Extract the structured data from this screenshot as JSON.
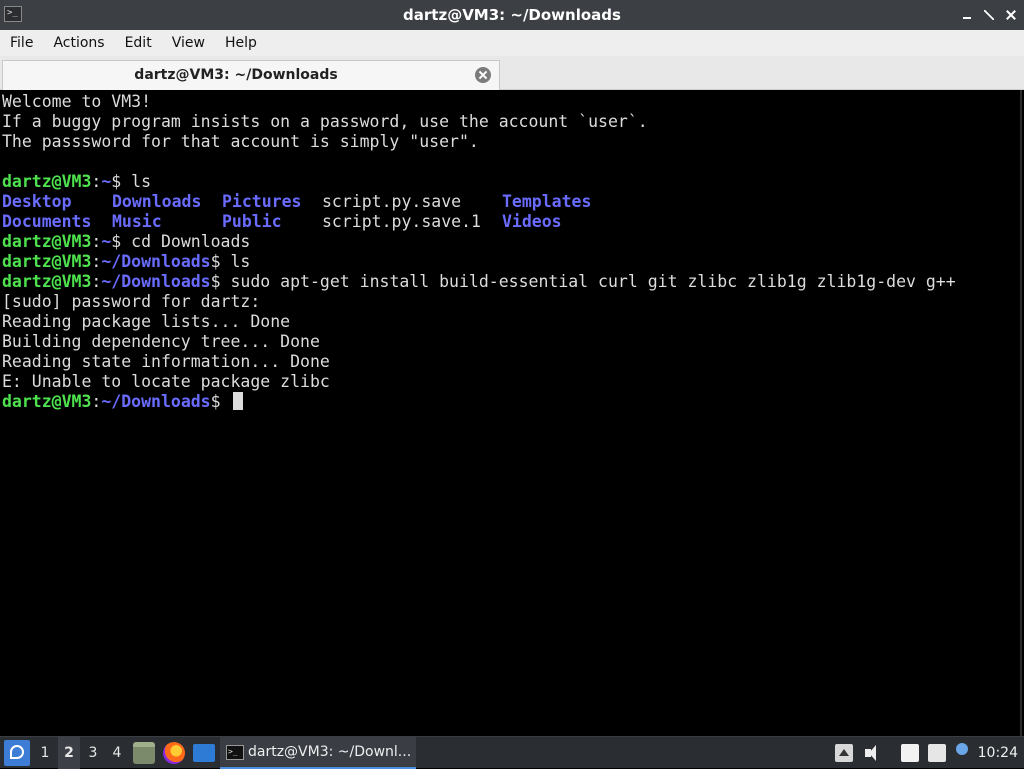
{
  "window": {
    "title": "dartz@VM3: ~/Downloads",
    "app_icon_text": ">_",
    "controls": [
      "minimize",
      "maximize",
      "close"
    ]
  },
  "menubar": {
    "items": [
      "File",
      "Actions",
      "Edit",
      "View",
      "Help"
    ]
  },
  "tabs": [
    {
      "label": "dartz@VM3: ~/Downloads",
      "active": true,
      "close_icon": "close-circle-icon"
    }
  ],
  "terminal": {
    "welcome": [
      "Welcome to VM3!",
      "If a buggy program insists on a password, use the account `user`.",
      "The passsword for that account is simply \"user\"."
    ],
    "prompt_user": "dartz@VM3",
    "prompt_colon": ":",
    "cmd1": {
      "path": "~",
      "dollar": "$ ",
      "command": "ls"
    },
    "ls_row1": [
      "Desktop",
      "Downloads",
      "Pictures",
      "script.py.save",
      "Templates"
    ],
    "ls_row2": [
      "Documents",
      "Music",
      "Public",
      "script.py.save.1",
      "Videos"
    ],
    "cmd2": {
      "path": "~",
      "dollar": "$ ",
      "command": "cd Downloads"
    },
    "cmd3": {
      "path": "~/Downloads",
      "dollar": "$ ",
      "command": "ls"
    },
    "cmd4": {
      "path": "~/Downloads",
      "dollar": "$ ",
      "command": "sudo apt-get install build-essential curl git zlibc zlib1g zlib1g-dev g++"
    },
    "output": [
      "[sudo] password for dartz:",
      "Reading package lists... Done",
      "Building dependency tree... Done",
      "Reading state information... Done",
      "E: Unable to locate package zlibc"
    ],
    "cmd5": {
      "path": "~/Downloads",
      "dollar": "$ ",
      "command": ""
    }
  },
  "taskbar": {
    "workspaces": [
      "1",
      "2",
      "3",
      "4"
    ],
    "active_workspace": "2",
    "launchers": [
      "file-manager-icon",
      "firefox-icon",
      "show-desktop-icon"
    ],
    "task_label": "dartz@VM3: ~/Downl...",
    "tray": [
      "tray-up-icon",
      "volume-icon",
      "clipboard-icon",
      "network-icon",
      "info-icon"
    ],
    "clock": "10:24"
  },
  "colors": {
    "prompt_user": "#4ee24e",
    "path_dir": "#6a6cff",
    "terminal_bg": "#000000",
    "titlebar_bg": "#3c3f44"
  }
}
